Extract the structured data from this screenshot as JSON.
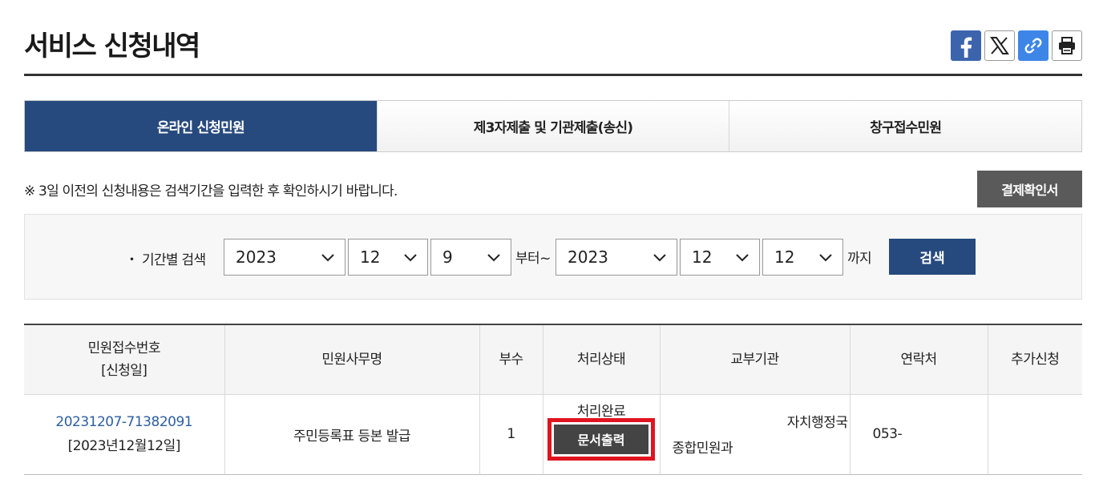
{
  "page": {
    "title": "서비스 신청내역"
  },
  "share": [
    {
      "name": "facebook",
      "icon": "facebook-icon"
    },
    {
      "name": "x",
      "icon": "x-icon"
    },
    {
      "name": "link",
      "icon": "link-icon"
    },
    {
      "name": "print",
      "icon": "printer-icon"
    }
  ],
  "tabs": [
    {
      "label": "온라인 신청민원",
      "active": true
    },
    {
      "label": "제3자제출 및 기관제출(송신)",
      "active": false
    },
    {
      "label": "창구접수민원",
      "active": false
    }
  ],
  "notice": "※ 3일 이전의 신청내용은 검색기간을 입력한 후 확인하시기 바랍니다.",
  "payment_button": "결제확인서",
  "search": {
    "label": "・ 기간별 검색",
    "from_year": "2023",
    "from_month": "12",
    "from_day": "9",
    "from_suffix": "부터~",
    "to_year": "2023",
    "to_month": "12",
    "to_day": "12",
    "to_suffix": "까지",
    "button": "검색"
  },
  "table": {
    "headers": {
      "receipt": "민원접수번호",
      "receipt_sub": "[신청일]",
      "name": "민원사무명",
      "copies": "부수",
      "status": "처리상태",
      "agency": "교부기관",
      "contact": "연락처",
      "extra": "추가신청"
    },
    "rows": [
      {
        "receipt_no": "20231207-71382091",
        "date": "[2023년12월12일]",
        "name": "주민등록표 등본 발급",
        "copies": "1",
        "status": "처리완료",
        "print_button": "문서출력",
        "agency_line1": "자치행정국",
        "agency_line2": "종합민원과",
        "contact": "053-",
        "extra": ""
      }
    ]
  },
  "colors": {
    "primary": "#274a7e",
    "facebook": "#3b64ad",
    "link": "#3d86e8",
    "highlight": "#e0141f",
    "pay_button": "#5a5a5a"
  }
}
